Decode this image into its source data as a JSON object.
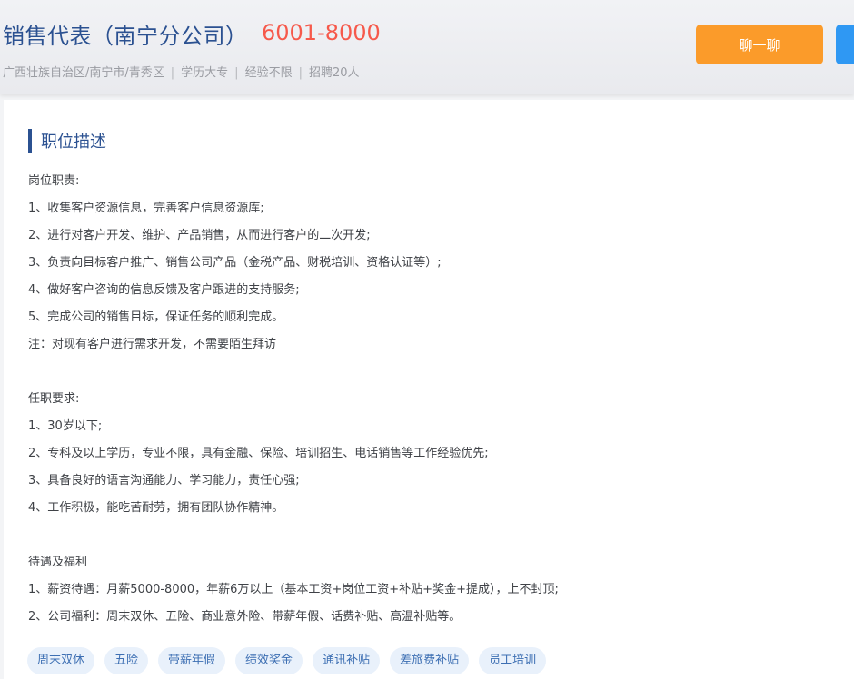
{
  "header": {
    "title": "销售代表（南宁分公司）",
    "salary": "6001-8000",
    "meta": [
      "广西壮族自治区/南宁市/青秀区",
      "学历大专",
      "经验不限",
      "招聘20人"
    ],
    "meta_sep": "|",
    "chat_label": "聊一聊"
  },
  "section": {
    "title": "职位描述"
  },
  "description": [
    "岗位职责:",
    "1、收集客户资源信息，完善客户信息资源库;",
    "2、进行对客户开发、维护、产品销售，从而进行客户的二次开发;",
    "3、负责向目标客户推广、销售公司产品（金税产品、财税培训、资格认证等）;",
    "4、做好客户咨询的信息反馈及客户跟进的支持服务;",
    "5、完成公司的销售目标，保证任务的顺利完成。",
    "注：对现有客户进行需求开发，不需要陌生拜访",
    "",
    "任职要求:",
    "1、30岁以下;",
    "2、专科及以上学历，专业不限，具有金融、保险、培训招生、电话销售等工作经验优先;",
    "3、具备良好的语言沟通能力、学习能力，责任心强;",
    "4、工作积极，能吃苦耐劳，拥有团队协作精神。",
    "",
    "待遇及福利",
    "1、薪资待遇：月薪5000-8000，年薪6万以上（基本工资+岗位工资+补贴+奖金+提成），上不封顶;",
    "2、公司福利：周末双休、五险、商业意外险、带薪年假、话费补贴、高温补贴等。"
  ],
  "tags": [
    "周末双休",
    "五险",
    "带薪年假",
    "绩效奖金",
    "通讯补贴",
    "差旅费补贴",
    "员工培训"
  ],
  "colors": {
    "brand_blue": "#2b5191",
    "salary_red": "#f6594b",
    "chat_orange": "#fb9b2a",
    "action_blue": "#2f98f3",
    "tag_bg": "#e9f1fb",
    "tag_text": "#3d6fb3"
  }
}
